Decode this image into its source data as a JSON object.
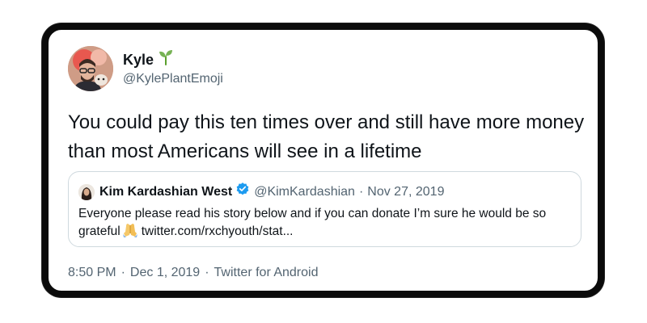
{
  "tweet": {
    "author": {
      "name": "Kyle",
      "name_emoji_icon": "seedling-icon",
      "handle": "@KylePlantEmoji",
      "avatar_icon": "avatar-icon"
    },
    "text": "You could pay this ten times over and still have more money than most Americans will see in a lifetime",
    "quoted": {
      "name": "Kim Kardashian West",
      "verified_icon": "verified-badge-icon",
      "handle": "@KimKardashian",
      "separator": "·",
      "date": "Nov 27, 2019",
      "text_before_emoji": "Everyone please read his story below and if you can donate I’m sure he would be so grateful",
      "emoji_icon": "folded-hands-icon",
      "link": "twitter.com/rxchyouth/stat..."
    },
    "meta": {
      "time": "8:50 PM",
      "separator": "·",
      "date": "Dec 1, 2019",
      "source": "Twitter for Android"
    }
  },
  "colors": {
    "text_primary": "#0f1419",
    "text_secondary": "#536471",
    "verified_blue": "#1d9bf0",
    "card_border": "#0b0b0b",
    "quote_border": "#cfd9de"
  }
}
